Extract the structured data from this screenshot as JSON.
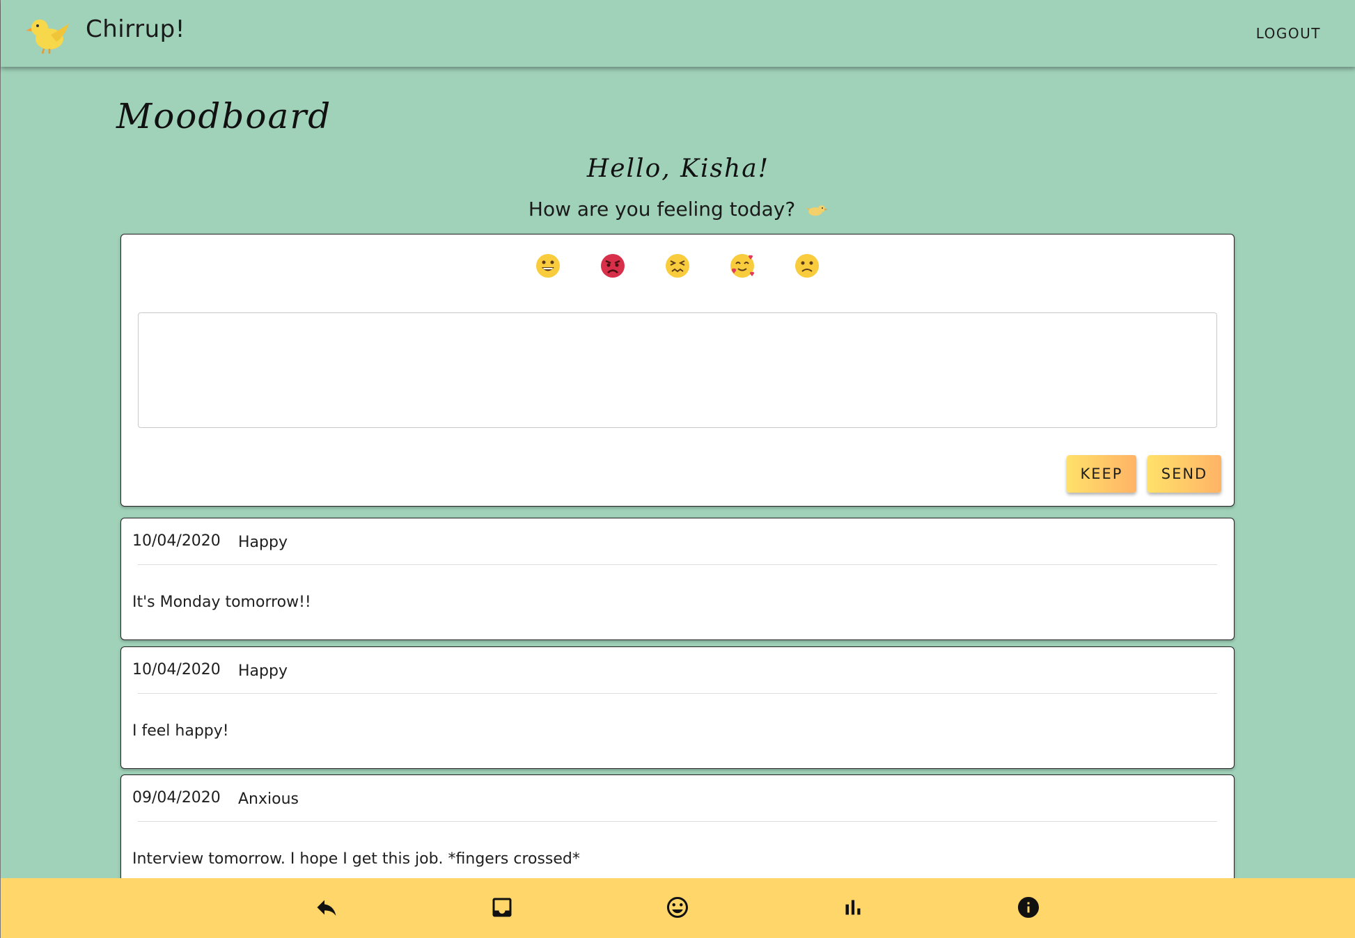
{
  "header": {
    "app_title": "Chirrup!",
    "logout_label": "LOGOUT"
  },
  "page": {
    "title": "Moodboard",
    "greeting": "Hello, Kisha!",
    "prompt": "How are you feeling today?"
  },
  "composer": {
    "moods": [
      "happy-face-icon",
      "angry-face-icon",
      "confounded-face-icon",
      "smiling-hearts-face-icon",
      "slightly-frowning-face-icon"
    ],
    "textarea_value": "",
    "keep_label": "KEEP",
    "send_label": "SEND"
  },
  "entries": [
    {
      "date": "10/04/2020",
      "mood": "Happy",
      "text": "It's Monday tomorrow!!"
    },
    {
      "date": "10/04/2020",
      "mood": "Happy",
      "text": "I feel happy!"
    },
    {
      "date": "09/04/2020",
      "mood": "Anxious",
      "text": "Interview tomorrow. I hope I get this job. *fingers crossed*"
    }
  ],
  "bottom_nav": [
    "reply-icon",
    "inbox-icon",
    "mood-face-icon",
    "stats-chart-icon",
    "info-icon"
  ],
  "colors": {
    "background": "#a0d1b9",
    "bottom_bar": "#ffd669",
    "button_gradient_start": "#ffe16a",
    "button_gradient_end": "#ffb366"
  }
}
